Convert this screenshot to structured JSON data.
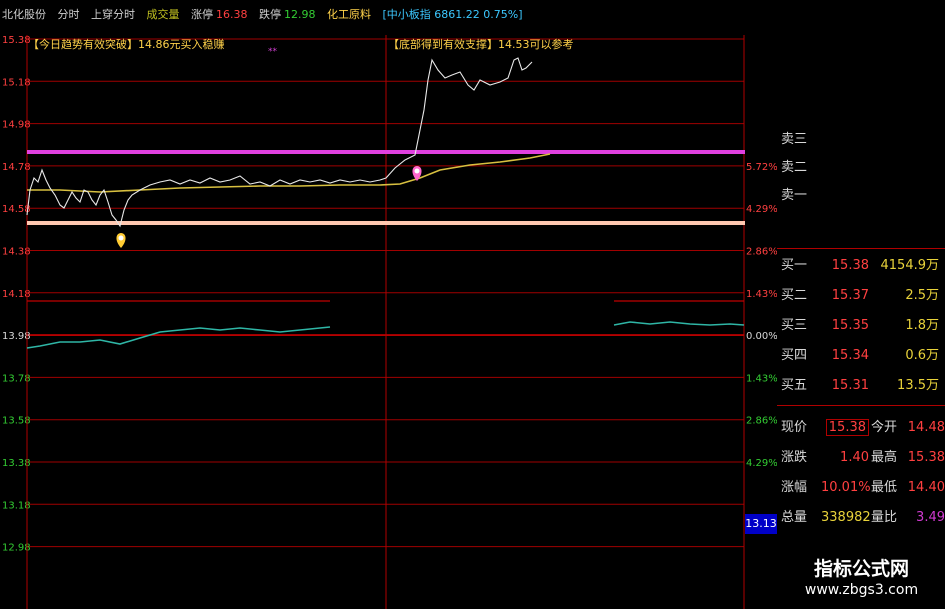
{
  "header": {
    "stock_name": "北化股份",
    "tab_intraday": "分时",
    "tab_index_intraday": "上穿分时",
    "volume_label": "成交量",
    "limit_up_label": "涨停",
    "limit_up_value": "16.38",
    "limit_down_label": "跌停",
    "limit_down_value": "12.98",
    "sector": "化工原料",
    "index_text": "[中小板指 6861.22 0.75%]"
  },
  "chart": {
    "price_ticks": [
      "15.38",
      "15.18",
      "14.98",
      "14.78",
      "14.58",
      "14.38",
      "14.18",
      "13.98",
      "13.78",
      "13.58",
      "13.38",
      "13.18",
      "12.98"
    ],
    "pct_ticks_up": [
      "5.72%",
      "4.29%",
      "2.86%",
      "1.43%"
    ],
    "pct_zero": "0.00%",
    "pct_ticks_down": [
      "1.43%",
      "2.86%",
      "4.29%"
    ],
    "annotation_left": "【今日趋势有效突破】14.86元买入稳赚",
    "annotation_right": "【底部得到有效支撑】14.53可以参考",
    "annotation_marker": "**",
    "current_price_tag": "13.13",
    "colors": {
      "grid": "#b00000",
      "price_line": "#e8e8e8",
      "avg_line": "#d8c040",
      "resistance": "#e040e0",
      "support": "#ffc8b0",
      "lower_line": "#2fb6a6"
    },
    "resistance_level": 14.82,
    "support_level": 14.55
  },
  "order_book": {
    "sell": [
      {
        "label": "卖三"
      },
      {
        "label": "卖二"
      },
      {
        "label": "卖一"
      }
    ],
    "buy": [
      {
        "label": "买一",
        "price": "15.38",
        "volume": "4154.9万"
      },
      {
        "label": "买二",
        "price": "15.37",
        "volume": "2.5万"
      },
      {
        "label": "买三",
        "price": "15.35",
        "volume": "1.8万"
      },
      {
        "label": "买四",
        "price": "15.34",
        "volume": "0.6万"
      },
      {
        "label": "买五",
        "price": "15.31",
        "volume": "13.5万"
      }
    ],
    "stats": {
      "current_label": "现价",
      "current": "15.38",
      "open_label": "今开",
      "open": "14.48",
      "change_label": "涨跌",
      "change": "1.40",
      "high_label": "最高",
      "high": "15.38",
      "change_pct_label": "涨幅",
      "change_pct": "10.01%",
      "low_label": "最低",
      "low": "14.40",
      "volume_label": "总量",
      "volume": "338982",
      "volume_ratio_label": "量比",
      "volume_ratio": "3.49"
    }
  },
  "watermark": {
    "title": "指标公式网",
    "url": "www.zbgs3.com"
  }
}
